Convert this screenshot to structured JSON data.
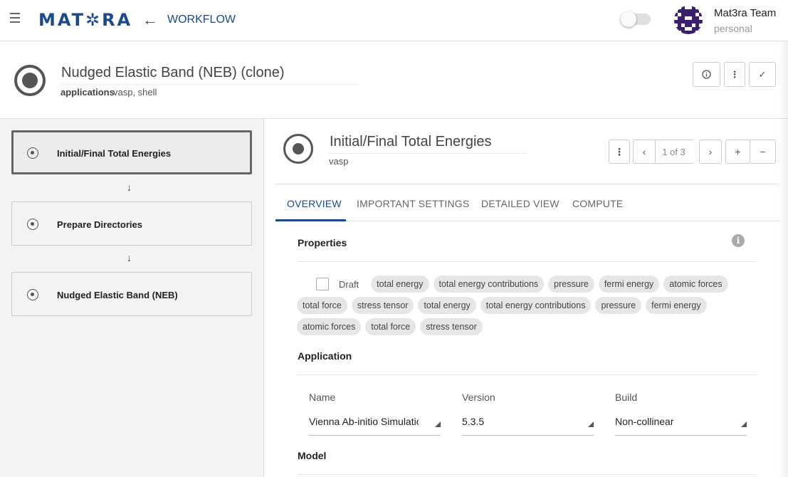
{
  "topbar": {
    "logo_text": "MAT✲RA",
    "section_label": "WORKFLOW",
    "user_name": "Mat3ra Team",
    "user_account": "personal"
  },
  "workflow": {
    "title": "Nudged Elastic Band (NEB) (clone)",
    "applications_label": "applications",
    "applications_value": "vasp, shell"
  },
  "units": [
    {
      "label": "Initial/Final Total Energies",
      "active": true
    },
    {
      "label": "Prepare Directories",
      "active": false
    },
    {
      "label": "Nudged Elastic Band (NEB)",
      "active": false
    }
  ],
  "unit_detail": {
    "title": "Initial/Final Total Energies",
    "application": "vasp",
    "pager": "1 of 3"
  },
  "tabs": [
    "OVERVIEW",
    "IMPORTANT SETTINGS",
    "DETAILED VIEW",
    "COMPUTE"
  ],
  "properties": {
    "section_title": "Properties",
    "draft_label": "Draft",
    "row1": [
      "total energy",
      "total energy contributions",
      "pressure",
      "fermi energy",
      "atomic forces"
    ],
    "row2": [
      "total force",
      "stress tensor",
      "total energy",
      "total energy contributions",
      "pressure",
      "fermi energy"
    ],
    "row3": [
      "atomic forces",
      "total force",
      "stress tensor"
    ]
  },
  "application": {
    "section_title": "Application",
    "name_label": "Name",
    "name_value": "Vienna Ab-initio Simulation Package",
    "version_label": "Version",
    "version_value": "5.3.5",
    "build_label": "Build",
    "build_value": "Non-collinear"
  },
  "model": {
    "section_title": "Model"
  },
  "colors": {
    "brand": "#1b4a8c",
    "chip_bg": "#e6e6e6",
    "sidebar_bg": "#f3f3f3"
  }
}
